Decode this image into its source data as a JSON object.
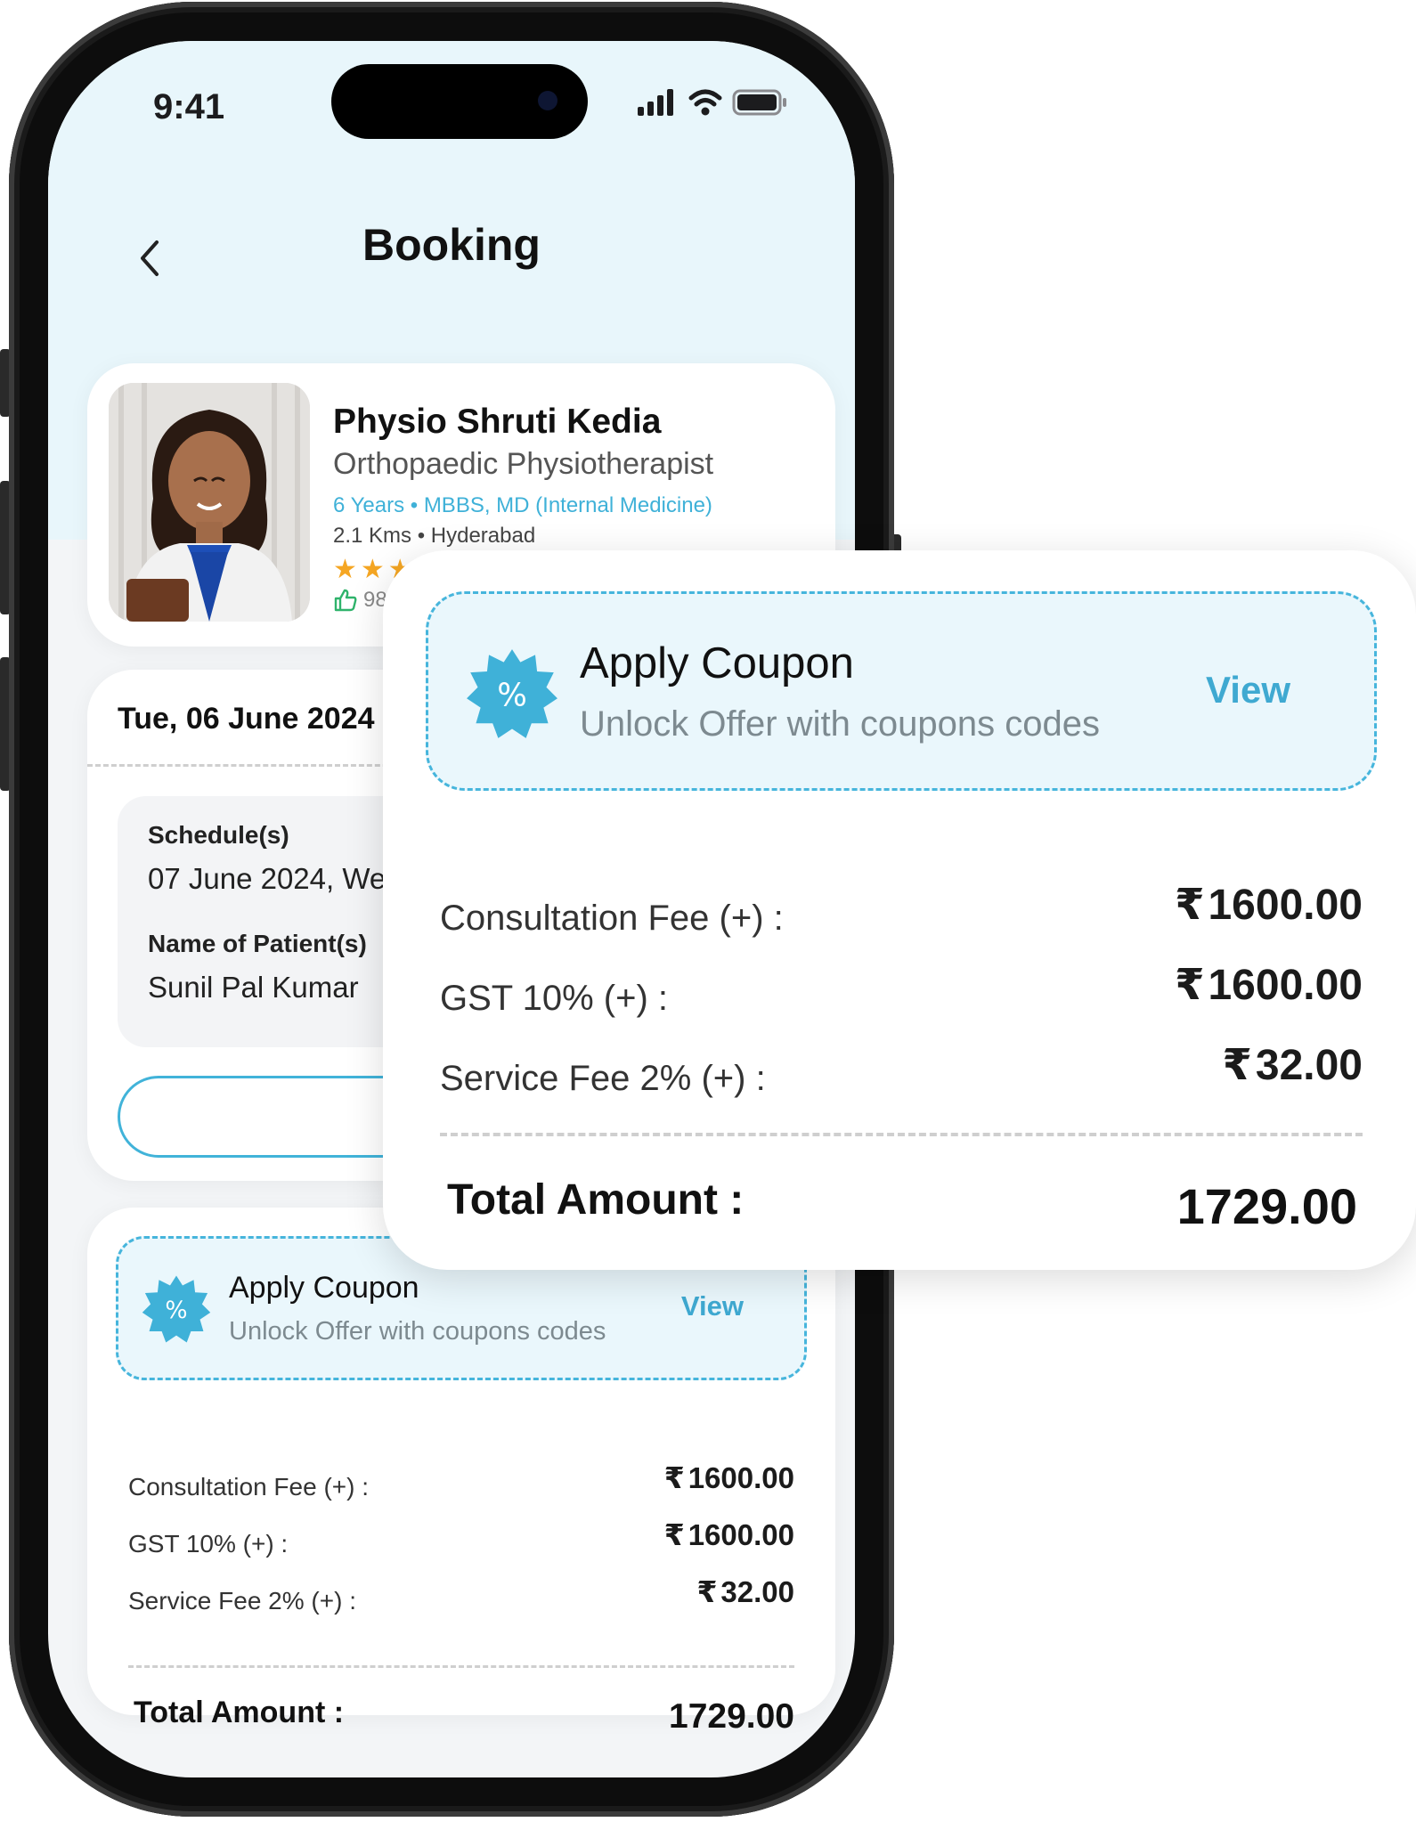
{
  "status_bar": {
    "time": "9:41"
  },
  "nav": {
    "title": "Booking"
  },
  "doctor": {
    "name": "Physio Shruti Kedia",
    "specialty": "Orthopaedic Physiotherapist",
    "qualifications": "6 Years • MBBS, MD (Internal Medicine)",
    "location": "2.1 Kms • Hyderabad",
    "rating_stars": "★★★",
    "likes": "98"
  },
  "schedule": {
    "date": "Tue, 06 June 2024",
    "schedule_label": "Schedule(s)",
    "schedule_value": "07 June 2024, We",
    "patient_label": "Name of Patient(s)",
    "patient_value": "Sunil Pal Kumar",
    "add_button": "+"
  },
  "coupon": {
    "title": "Apply Coupon",
    "subtitle": "Unlock Offer with coupons codes",
    "view": "View",
    "badge": "%"
  },
  "billing": {
    "currency": "₹",
    "rows": [
      {
        "label": "Consultation Fee (+) :",
        "value": "1600.00"
      },
      {
        "label": "GST 10% (+) :",
        "value": "1600.00"
      },
      {
        "label": "Service Fee 2% (+) :",
        "value": "32.00"
      }
    ],
    "total_label": "Total Amount :",
    "total_value": "1729.00"
  },
  "colors": {
    "accent": "#41b3d9",
    "coupon_bg": "#eaf7fc",
    "header_bg": "#e8f6fb",
    "star": "#f5a623"
  }
}
